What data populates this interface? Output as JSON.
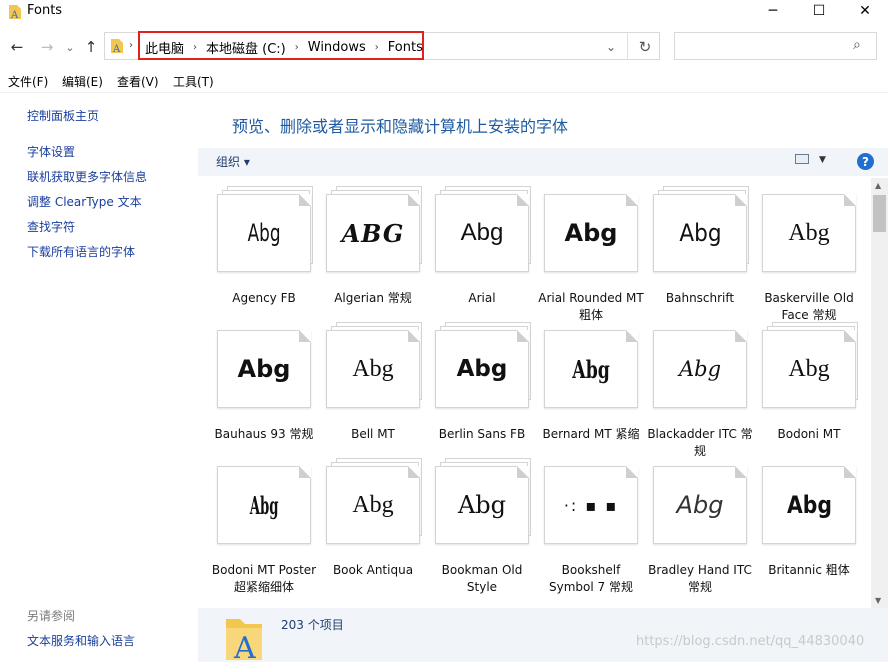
{
  "window": {
    "title": "Fonts",
    "minimize": "─",
    "maximize": "☐",
    "close": "✕"
  },
  "nav": {
    "back": "←",
    "forward": "→",
    "recent": "⌄",
    "up": "↑",
    "refresh": "↻",
    "dropdown": "⌄"
  },
  "breadcrumb": [
    "此电脑",
    "本地磁盘 (C:)",
    "Windows",
    "Fonts"
  ],
  "breadcrumb_sep": "›",
  "search": {
    "placeholder": "",
    "icon": "⌕"
  },
  "menus": [
    "文件(F)",
    "编辑(E)",
    "查看(V)",
    "工具(T)"
  ],
  "left_pane": {
    "home": "控制面板主页",
    "links": [
      "字体设置",
      "联机获取更多字体信息",
      "调整 ClearType 文本",
      "查找字符",
      "下载所有语言的字体"
    ],
    "see_also": "另请参阅",
    "bottom_link": "文本服务和输入语言"
  },
  "heading": "预览、删除或者显示和隐藏计算机上安装的字体",
  "toolbar": {
    "organize": "组织 ▾",
    "help": "?",
    "view_arrow": "▼"
  },
  "fonts": [
    {
      "name": "Agency FB",
      "sample": "Abg",
      "stack": true
    },
    {
      "name": "Algerian 常规",
      "sample": "ABG",
      "stack": true
    },
    {
      "name": "Arial",
      "sample": "Abg",
      "stack": true
    },
    {
      "name": "Arial Rounded MT 粗体",
      "sample": "Abg",
      "stack": false
    },
    {
      "name": "Bahnschrift",
      "sample": "Abg",
      "stack": true
    },
    {
      "name": "Baskerville Old Face 常规",
      "sample": "Abg",
      "stack": false
    },
    {
      "name": "Bauhaus 93 常规",
      "sample": "Abg",
      "stack": false
    },
    {
      "name": "Bell MT",
      "sample": "Abg",
      "stack": true
    },
    {
      "name": "Berlin Sans FB",
      "sample": "Abg",
      "stack": true
    },
    {
      "name": "Bernard MT 紧缩",
      "sample": "Abg",
      "stack": false
    },
    {
      "name": "Blackadder ITC 常规",
      "sample": "Abg",
      "stack": false
    },
    {
      "name": "Bodoni MT",
      "sample": "Abg",
      "stack": true
    },
    {
      "name": "Bodoni MT Poster 超紧缩细体",
      "sample": "Abg",
      "stack": false
    },
    {
      "name": "Book Antiqua",
      "sample": "Abg",
      "stack": true
    },
    {
      "name": "Bookman Old Style",
      "sample": "Abg",
      "stack": true
    },
    {
      "name": "Bookshelf Symbol 7 常规",
      "sample": "·:  ▪  ▪",
      "stack": false
    },
    {
      "name": "Bradley Hand ITC 常规",
      "sample": "Abg",
      "stack": false
    },
    {
      "name": "Britannic 粗体",
      "sample": "Abg",
      "stack": false
    }
  ],
  "status": {
    "count": "203 个项目"
  },
  "watermark": "https://blog.csdn.net/qq_44830040",
  "colors": {
    "accent": "#1e5aa0",
    "highlight": "#e0221c",
    "pane": "#f1f4f9"
  }
}
